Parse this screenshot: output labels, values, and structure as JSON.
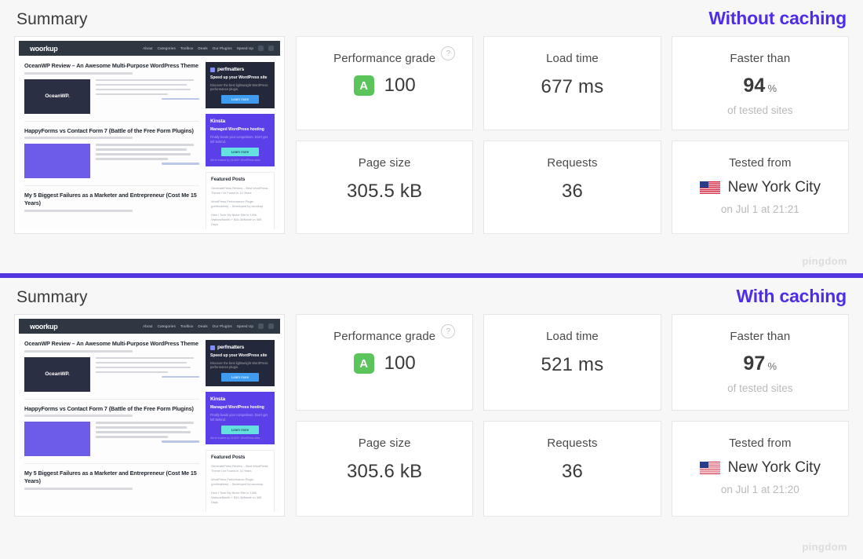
{
  "panels": [
    {
      "summary_title": "Summary",
      "caching_label": "Without caching",
      "watermark": "pingdom",
      "cards": {
        "performance": {
          "label": "Performance grade",
          "help_icon": "question-mark-icon",
          "grade": "A",
          "score": "100"
        },
        "load_time": {
          "label": "Load time",
          "value": "677 ms"
        },
        "faster_than": {
          "label": "Faster than",
          "value": "94",
          "unit": "%",
          "sub": "of tested sites"
        },
        "page_size": {
          "label": "Page size",
          "value": "305.5 kB"
        },
        "requests": {
          "label": "Requests",
          "value": "36"
        },
        "tested_from": {
          "label": "Tested from",
          "flag": "us-flag-icon",
          "location": "New York City",
          "sub": "on Jul 1 at 21:21"
        }
      }
    },
    {
      "summary_title": "Summary",
      "caching_label": "With caching",
      "watermark": "pingdom",
      "cards": {
        "performance": {
          "label": "Performance grade",
          "help_icon": "question-mark-icon",
          "grade": "A",
          "score": "100"
        },
        "load_time": {
          "label": "Load time",
          "value": "521 ms"
        },
        "faster_than": {
          "label": "Faster than",
          "value": "97",
          "unit": "%",
          "sub": "of tested sites"
        },
        "page_size": {
          "label": "Page size",
          "value": "305.6 kB"
        },
        "requests": {
          "label": "Requests",
          "value": "36"
        },
        "tested_from": {
          "label": "Tested from",
          "flag": "us-flag-icon",
          "location": "New York City",
          "sub": "on Jul 1 at 21:20"
        }
      }
    }
  ],
  "thumbnail": {
    "site_logo": "woorkup",
    "nav": [
      "About",
      "Categories",
      "Toolbox",
      "Deals",
      "Our Plugins",
      "Speed Up"
    ],
    "nav_icons": [
      "cart-icon",
      "search-icon"
    ],
    "posts": [
      {
        "title": "OceanWP Review – An Awesome Multi-Purpose WordPress Theme",
        "thumb_text": "OceanWP."
      },
      {
        "title": "HappyForms vs Contact Form 7 (Battle of the Free Form Plugins)",
        "thumb_text": ""
      },
      {
        "title": "My 5 Biggest Failures as a Marketer and Entrepreneur (Cost Me 15 Years)",
        "thumb_text": ""
      }
    ],
    "ads": [
      {
        "brand": "perfmatters",
        "headline": "Speed up your WordPress site",
        "sub": "Discover the best lightweight WordPress performance plugin.",
        "button": "Learn more",
        "foot": ""
      },
      {
        "brand": "Kinsta",
        "headline": "Managed WordPress hosting",
        "sub": "Finally beats your competitors. Don't get left behind.",
        "button": "Learn more",
        "foot": "We're trusted by 24,000+ WordPress sites."
      }
    ],
    "featured": {
      "title": "Featured Posts",
      "items": [
        "GeneratePress Review – Best WordPress Theme I've Found in 10 Years",
        "WordPress Performance Plugin (perfmatters) – Developed by woorkup",
        "How I Took My Niche Site to 100k Visitors/Month + $16.3k/Month in 365 Days"
      ]
    }
  },
  "colors": {
    "accent_purple": "#5236e0",
    "grade_green": "#5bc45b",
    "background": "#f7f7f7"
  }
}
